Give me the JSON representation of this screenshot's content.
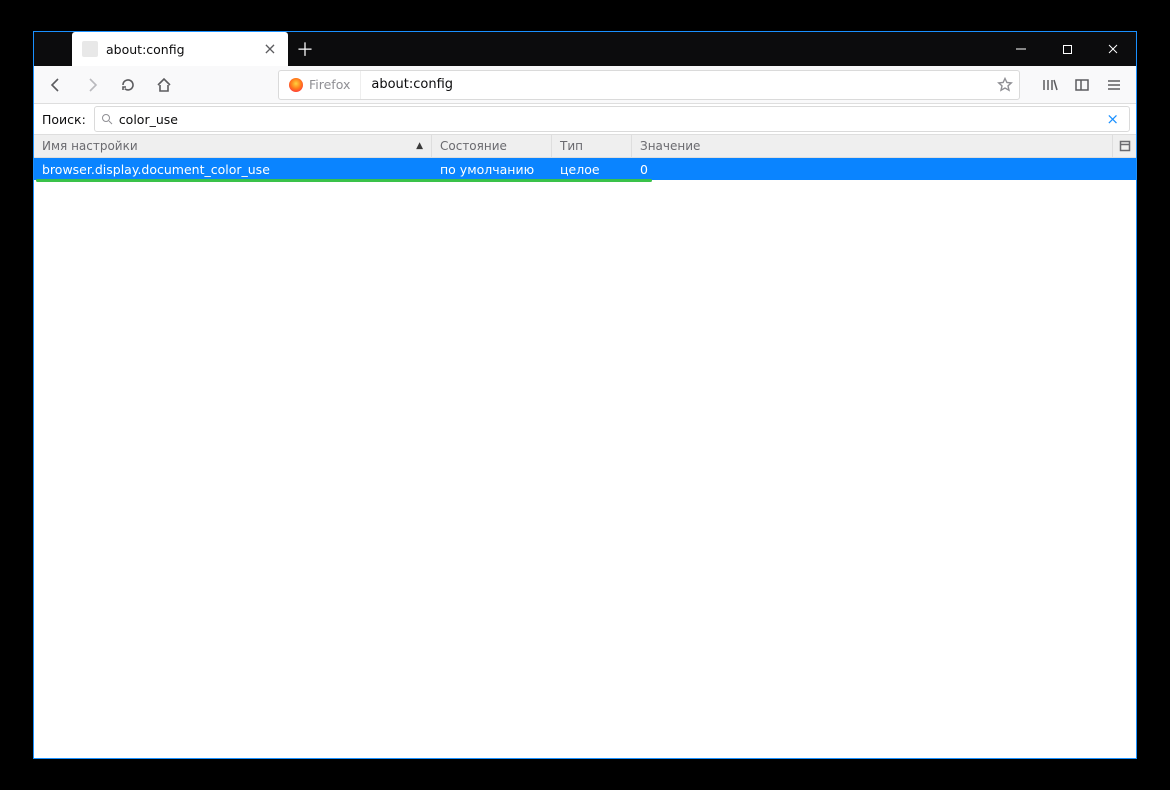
{
  "tab": {
    "title": "about:config"
  },
  "urlbar": {
    "identity_label": "Firefox",
    "value": "about:config"
  },
  "config_search": {
    "label": "Поиск:",
    "value": "color_use"
  },
  "columns": {
    "name": "Имя настройки",
    "status": "Состояние",
    "type": "Тип",
    "value": "Значение"
  },
  "rows": [
    {
      "name": "browser.display.document_color_use",
      "status": "по умолчанию",
      "type": "целое",
      "value": "0"
    }
  ]
}
